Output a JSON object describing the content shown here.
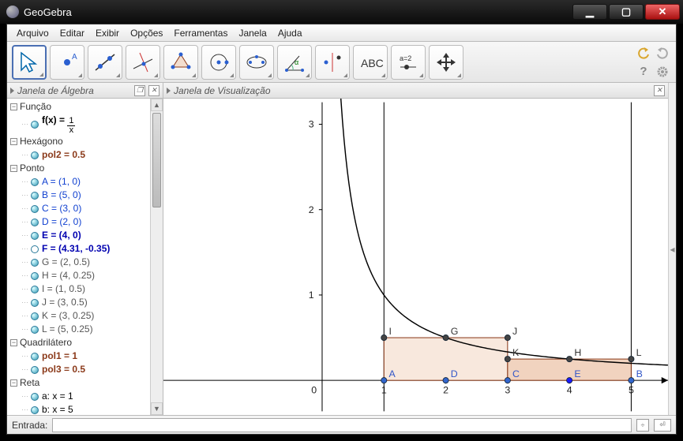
{
  "window": {
    "title": "GeoGebra"
  },
  "menu": {
    "items": [
      "Arquivo",
      "Editar",
      "Exibir",
      "Opções",
      "Ferramentas",
      "Janela",
      "Ajuda"
    ]
  },
  "panels": {
    "algebra_title": "Janela de Álgebra",
    "graphics_title": "Janela de Visualização"
  },
  "input": {
    "label": "Entrada:",
    "value": ""
  },
  "algebra": {
    "categories": [
      {
        "name": "Função",
        "items": [
          {
            "label": "f(x) = ",
            "frac_num": "1",
            "frac_den": "x",
            "cls": "c-black",
            "ball": "solid"
          }
        ]
      },
      {
        "name": "Hexágono",
        "items": [
          {
            "label": "pol2 = 0.5",
            "cls": "c-brown",
            "ball": "solid"
          }
        ]
      },
      {
        "name": "Ponto",
        "items": [
          {
            "label": "A = (1, 0)",
            "cls": "c-blue",
            "ball": "solid"
          },
          {
            "label": "B = (5, 0)",
            "cls": "c-blue",
            "ball": "solid"
          },
          {
            "label": "C = (3, 0)",
            "cls": "c-blue",
            "ball": "solid"
          },
          {
            "label": "D = (2, 0)",
            "cls": "c-blue",
            "ball": "solid"
          },
          {
            "label": "E = (4, 0)",
            "cls": "c-darkblue",
            "ball": "solid"
          },
          {
            "label": "F = (4.31, -0.35)",
            "cls": "c-darkblue",
            "ball": "hollow"
          },
          {
            "label": "G = (2, 0.5)",
            "cls": "c-gray",
            "ball": "solid"
          },
          {
            "label": "H = (4, 0.25)",
            "cls": "c-gray",
            "ball": "solid"
          },
          {
            "label": "I = (1, 0.5)",
            "cls": "c-gray",
            "ball": "solid"
          },
          {
            "label": "J = (3, 0.5)",
            "cls": "c-gray",
            "ball": "solid"
          },
          {
            "label": "K = (3, 0.25)",
            "cls": "c-gray",
            "ball": "solid"
          },
          {
            "label": "L = (5, 0.25)",
            "cls": "c-gray",
            "ball": "solid"
          }
        ]
      },
      {
        "name": "Quadrilátero",
        "items": [
          {
            "label": "pol1 = 1",
            "cls": "c-brown",
            "ball": "solid"
          },
          {
            "label": "pol3 = 0.5",
            "cls": "c-brown",
            "ball": "solid"
          }
        ]
      },
      {
        "name": "Reta",
        "items": [
          {
            "label": "a: x = 1",
            "cls": "c-black",
            "ball": "solid"
          },
          {
            "label": "b: x = 5",
            "cls": "c-black",
            "ball": "solid"
          }
        ]
      }
    ]
  },
  "chart_data": {
    "type": "line",
    "title": "",
    "xlabel": "",
    "ylabel": "",
    "xlim": [
      0,
      5.2
    ],
    "ylim": [
      -0.5,
      3.3
    ],
    "xticks": [
      0,
      1,
      2,
      3,
      4,
      5
    ],
    "yticks": [
      0,
      1,
      2,
      3
    ],
    "series": [
      {
        "name": "f(x)=1/x",
        "type": "curve",
        "expr": "1/x",
        "domain": [
          0.3,
          5.2
        ]
      }
    ],
    "vlines": [
      {
        "name": "a",
        "x": 1
      },
      {
        "name": "b",
        "x": 5
      }
    ],
    "points": [
      {
        "name": "A",
        "x": 1,
        "y": 0,
        "color": "#3366cc"
      },
      {
        "name": "B",
        "x": 5,
        "y": 0,
        "color": "#3366cc"
      },
      {
        "name": "C",
        "x": 3,
        "y": 0,
        "color": "#3366cc"
      },
      {
        "name": "D",
        "x": 2,
        "y": 0,
        "color": "#3366cc"
      },
      {
        "name": "E",
        "x": 4,
        "y": 0,
        "color": "#1a1aff"
      },
      {
        "name": "G",
        "x": 2,
        "y": 0.5,
        "color": "#444"
      },
      {
        "name": "H",
        "x": 4,
        "y": 0.25,
        "color": "#444"
      },
      {
        "name": "I",
        "x": 1,
        "y": 0.5,
        "color": "#444"
      },
      {
        "name": "J",
        "x": 3,
        "y": 0.5,
        "color": "#444"
      },
      {
        "name": "K",
        "x": 3,
        "y": 0.25,
        "color": "#444"
      },
      {
        "name": "L",
        "x": 5,
        "y": 0.25,
        "color": "#444"
      }
    ],
    "polygons": [
      {
        "name": "pol1",
        "vertices": [
          [
            1,
            0
          ],
          [
            3,
            0
          ],
          [
            3,
            0.5
          ],
          [
            1,
            0.5
          ]
        ],
        "area": 1,
        "fill": "#f8e3d8"
      },
      {
        "name": "pol3",
        "vertices": [
          [
            3,
            0
          ],
          [
            5,
            0
          ],
          [
            5,
            0.25
          ],
          [
            3,
            0.25
          ]
        ],
        "area": 0.5,
        "fill": "#f0cdb8"
      },
      {
        "name": "pol2",
        "vertices": [
          [
            1,
            0
          ],
          [
            1,
            0.5
          ],
          [
            2,
            0.5
          ],
          [
            3,
            0.5
          ],
          [
            3,
            0.25
          ],
          [
            3,
            0
          ]
        ],
        "area": 0.5,
        "fill": "#f8e3d8"
      }
    ]
  }
}
